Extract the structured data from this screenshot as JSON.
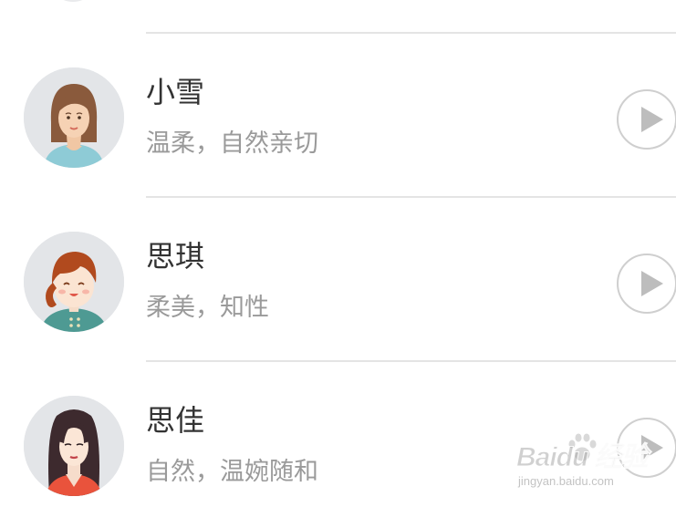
{
  "voice_list": {
    "items": [
      {
        "name": "小雪",
        "description": "温柔，自然亲切",
        "avatar_icon": "woman-brown-hair-avatar-icon",
        "play_icon": "play-icon"
      },
      {
        "name": "思琪",
        "description": "柔美，知性",
        "avatar_icon": "smiling-girl-ponytail-avatar-icon",
        "play_icon": "play-icon"
      },
      {
        "name": "思佳",
        "description": "自然，温婉随和",
        "avatar_icon": "woman-long-dark-hair-avatar-icon",
        "play_icon": "play-icon"
      }
    ]
  },
  "watermark": {
    "logo": "Baidu 经验",
    "url": "jingyan.baidu.com"
  },
  "colors": {
    "name_text": "#333333",
    "description_text": "#9a9a9a",
    "divider": "#e4e4e4",
    "play_button_border": "#cfcfcf",
    "play_icon": "#bdbdbd",
    "avatar_background": "#e3e5e8"
  }
}
